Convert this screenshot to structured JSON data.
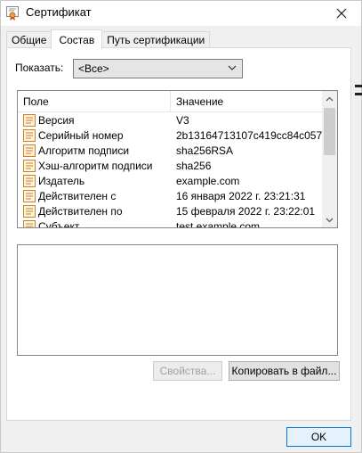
{
  "window": {
    "title": "Сертификат",
    "close_icon": "close-icon",
    "title_icon": "certificate-icon"
  },
  "tabs": [
    {
      "label": "Общие",
      "active": false
    },
    {
      "label": "Состав",
      "active": true
    },
    {
      "label": "Путь сертификации",
      "active": false
    }
  ],
  "show": {
    "label": "Показать:",
    "selected": "<Все>"
  },
  "list": {
    "columns": [
      "Поле",
      "Значение"
    ],
    "rows": [
      {
        "field": "Версия",
        "value": "V3"
      },
      {
        "field": "Серийный номер",
        "value": "2b13164713107c419cc84c057..."
      },
      {
        "field": "Алгоритм подписи",
        "value": "sha256RSA"
      },
      {
        "field": "Хэш-алгоритм подписи",
        "value": "sha256"
      },
      {
        "field": "Издатель",
        "value": "example.com"
      },
      {
        "field": "Действителен с",
        "value": "16 января 2022 г. 23:21:31"
      },
      {
        "field": "Действителен по",
        "value": "15 февраля 2022 г. 23:22:01"
      },
      {
        "field": "Субъект",
        "value": "test.example.com"
      }
    ]
  },
  "buttons": {
    "properties": "Свойства...",
    "copy_to_file": "Копировать в файл...",
    "ok": "OK"
  },
  "colors": {
    "ok_border": "#0078d7",
    "icon_orange": "#e8a23a"
  }
}
